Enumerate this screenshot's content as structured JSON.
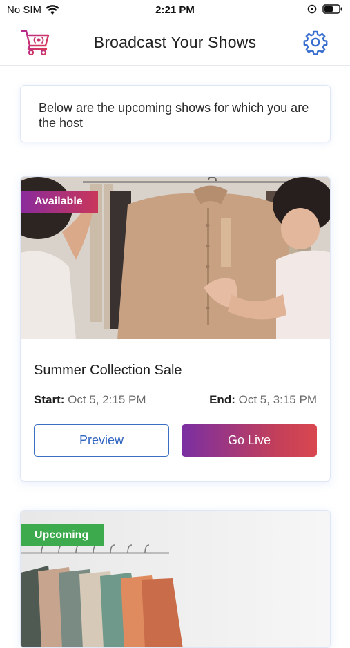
{
  "status_bar": {
    "carrier": "No SIM",
    "time": "2:21 PM"
  },
  "header": {
    "title": "Broadcast Your Shows",
    "logo_icon": "shopping-cart-broadcast-icon",
    "settings_icon": "gear-icon"
  },
  "info": {
    "text": "Below are the upcoming shows for which you are the host"
  },
  "shows": [
    {
      "status": "Available",
      "title": "Summer Collection Sale",
      "start_label": "Start:",
      "start_value": "Oct 5, 2:15 PM",
      "end_label": "End:",
      "end_value": "Oct 5, 3:15 PM",
      "preview_label": "Preview",
      "golive_label": "Go Live"
    },
    {
      "status": "Upcoming"
    }
  ],
  "colors": {
    "accent_blue": "#2f64c0",
    "gradient_start": "#7a2fa3",
    "gradient_end": "#d9474f",
    "upcoming_green": "#3caa4d"
  }
}
